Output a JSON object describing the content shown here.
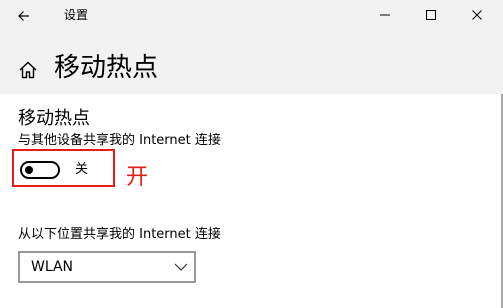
{
  "window": {
    "title": "设置"
  },
  "header": {
    "title": "移动热点"
  },
  "hotspot": {
    "section_title": "移动热点",
    "share_label": "与其他设备共享我的 Internet 连接",
    "toggle_state_label": "关",
    "toggle_on": false,
    "from_label": "从以下位置共享我的 Internet 连接",
    "connection_selected": "WLAN"
  },
  "annotation": {
    "text": "开",
    "color": "#e61b1b"
  },
  "icons": {
    "back": "back-arrow-icon",
    "home": "home-icon",
    "minimize": "minimize-icon",
    "maximize": "maximize-icon",
    "close": "close-icon",
    "chevron": "chevron-down-icon"
  }
}
